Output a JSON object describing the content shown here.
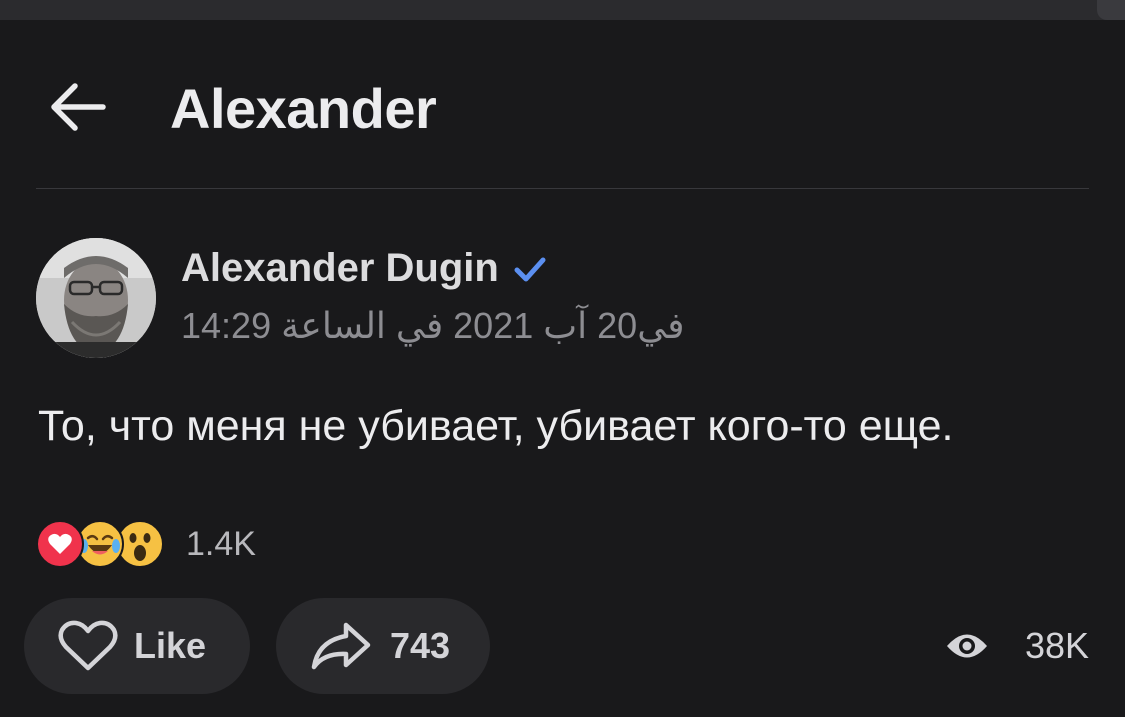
{
  "header": {
    "title": "Alexander",
    "back_icon": "arrow-left-icon"
  },
  "post": {
    "author": "Alexander Dugin",
    "verified": true,
    "timestamp": "في20 آب 2021 في الساعة 14:29",
    "text": "То, что меня не убивает, убивает кого-то еще."
  },
  "reactions": {
    "icons": [
      "heart-icon",
      "laughing-emoji-icon",
      "surprised-emoji-icon"
    ],
    "count": "1.4K"
  },
  "actions": {
    "like_label": "Like",
    "share_count": "743",
    "views_count": "38K"
  },
  "colors": {
    "background": "#19191b",
    "pill": "#29292c",
    "verified": "#5b8ff0",
    "heart": "#f0334c"
  }
}
